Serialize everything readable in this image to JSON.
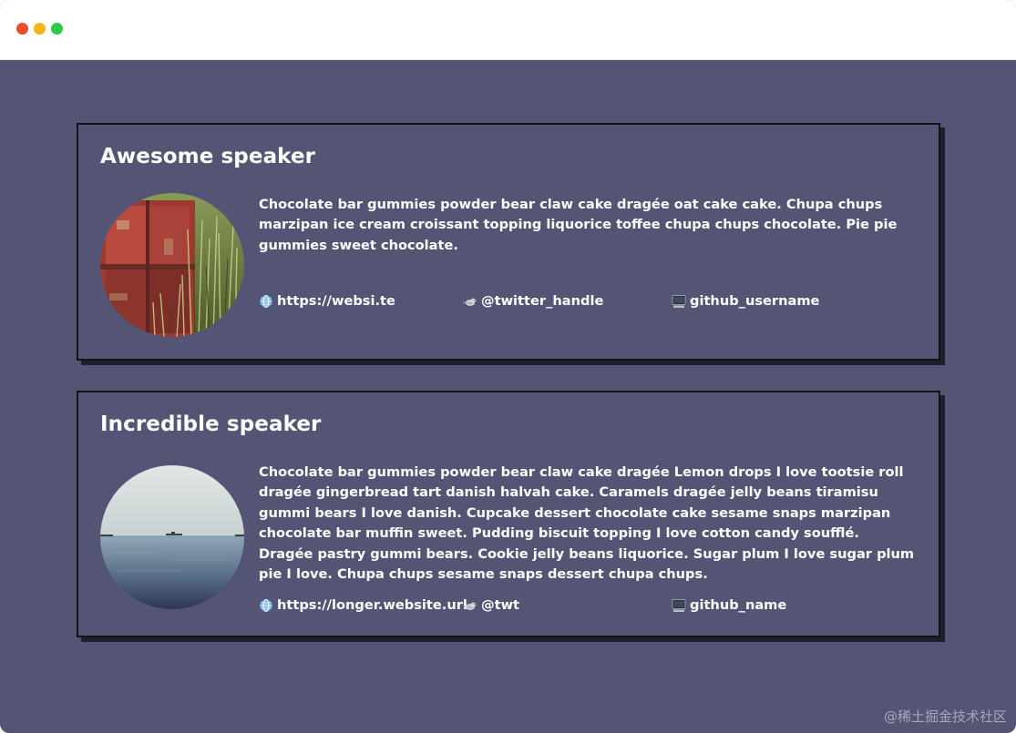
{
  "window": {
    "controls": [
      "close-dot",
      "minimize-dot",
      "maximize-dot"
    ]
  },
  "colors": {
    "background": "#545575",
    "card_border": "#141414",
    "card_shadow": "#1f1f2c",
    "text": "#ffffff"
  },
  "speakers": [
    {
      "title": "Awesome speaker",
      "avatar": "photo of red rusted door with tall grass",
      "bio": "Chocolate bar gummies powder bear claw cake dragée oat cake cake. Chupa chups marzipan ice cream croissant topping liquorice toffee chupa chups chocolate. Pie pie gummies sweet chocolate.",
      "website": "https://websi.te",
      "twitter": "@twitter_handle",
      "github": "github_username"
    },
    {
      "title": "Incredible speaker",
      "avatar": "photo of calm sea with ships on horizon",
      "bio": "Chocolate bar gummies powder bear claw cake dragée Lemon drops I love tootsie roll dragée gingerbread tart danish halvah cake. Caramels dragée jelly beans tiramisu gummi bears I love danish. Cupcake dessert chocolate cake sesame snaps marzipan chocolate bar muffin sweet. Pudding biscuit topping I love cotton candy soufflé. Dragée pastry gummi bears. Cookie jelly beans liquorice. Sugar plum I love sugar plum pie I love. Chupa chups sesame snaps dessert chupa chups.",
      "website": "https://longer.website.url",
      "twitter": "@twt",
      "github": "github_name"
    }
  ],
  "icons": {
    "website": "globe-icon",
    "twitter": "bird-icon",
    "github": "computer-icon"
  },
  "watermark": "@稀土掘金技术社区"
}
